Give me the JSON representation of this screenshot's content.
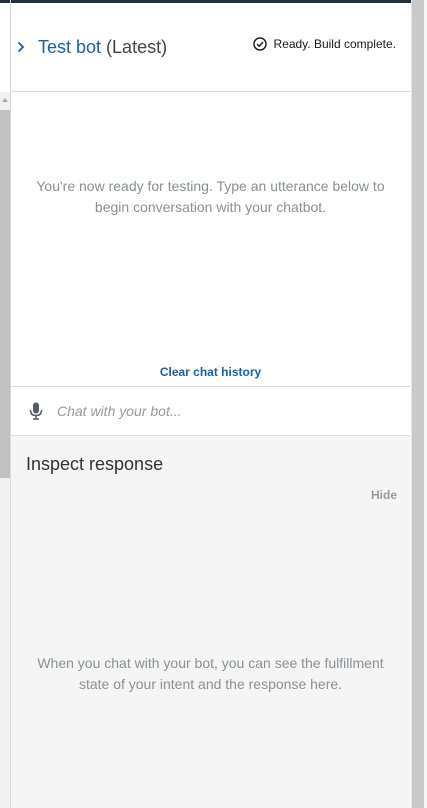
{
  "header": {
    "bot_name": "Test bot",
    "version": " (Latest)",
    "status_text": "Ready. Build complete."
  },
  "chat": {
    "empty_message": "You're now ready for testing. Type an utterance below to begin conversation with your chatbot.",
    "clear_history_label": "Clear chat history",
    "input_placeholder": "Chat with your bot..."
  },
  "inspect": {
    "title": "Inspect response",
    "hide_label": "Hide",
    "empty_message": "When you chat with your bot, you can see the fulfillment state of your intent and the response here."
  },
  "colors": {
    "link": "#1b5fa3",
    "muted_text": "#879196",
    "border": "#d5dbdb",
    "inspect_bg": "#f5f5f5"
  },
  "icons": {
    "collapse": "chevron-right-icon",
    "status": "check-circle-icon",
    "microphone": "microphone-icon"
  }
}
